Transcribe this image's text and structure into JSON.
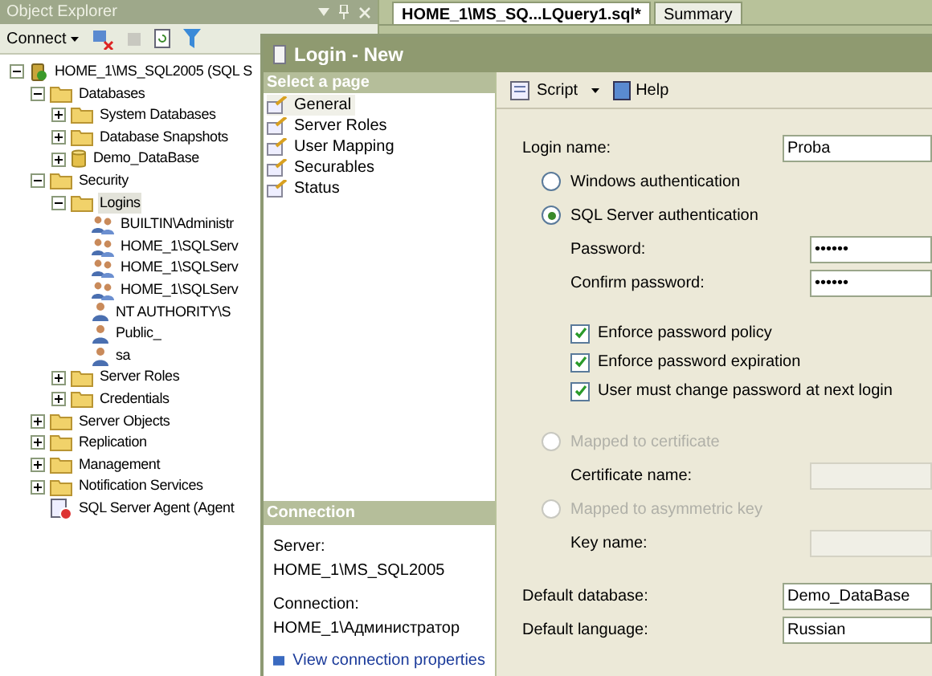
{
  "object_explorer": {
    "title": "Object Explorer",
    "connect": "Connect",
    "tree": [
      {
        "label": "HOME_1\\MS_SQL2005 (SQL S",
        "kind": "server",
        "expanded": true,
        "children": [
          {
            "label": "Databases",
            "kind": "folder",
            "expanded": true,
            "children": [
              {
                "label": "System Databases",
                "kind": "folder",
                "expanded": false
              },
              {
                "label": "Database Snapshots",
                "kind": "folder",
                "expanded": false
              },
              {
                "label": "Demo_DataBase",
                "kind": "database",
                "expanded": false
              }
            ]
          },
          {
            "label": "Security",
            "kind": "folder",
            "expanded": true,
            "children": [
              {
                "label": "Logins",
                "kind": "folder",
                "expanded": true,
                "selected": true,
                "children": [
                  {
                    "label": "BUILTIN\\Administr",
                    "kind": "group"
                  },
                  {
                    "label": "HOME_1\\SQLServ",
                    "kind": "group"
                  },
                  {
                    "label": "HOME_1\\SQLServ",
                    "kind": "group"
                  },
                  {
                    "label": "HOME_1\\SQLServ",
                    "kind": "group"
                  },
                  {
                    "label": "NT AUTHORITY\\S",
                    "kind": "user"
                  },
                  {
                    "label": "Public_",
                    "kind": "user"
                  },
                  {
                    "label": "sa",
                    "kind": "user"
                  }
                ]
              },
              {
                "label": "Server Roles",
                "kind": "folder",
                "expanded": false
              },
              {
                "label": "Credentials",
                "kind": "folder",
                "expanded": false
              }
            ]
          },
          {
            "label": "Server Objects",
            "kind": "folder",
            "expanded": false
          },
          {
            "label": "Replication",
            "kind": "folder",
            "expanded": false
          },
          {
            "label": "Management",
            "kind": "folder",
            "expanded": false
          },
          {
            "label": "Notification Services",
            "kind": "folder",
            "expanded": false
          },
          {
            "label": "SQL Server Agent (Agent",
            "kind": "agent"
          }
        ]
      }
    ]
  },
  "document_tabs": [
    {
      "label": "HOME_1\\MS_SQ...LQuery1.sql*",
      "selected": true
    },
    {
      "label": "Summary",
      "selected": false
    }
  ],
  "dialog": {
    "title": "Login - New",
    "select_page": {
      "heading": "Select a page",
      "items": [
        {
          "label": "General",
          "selected": true
        },
        {
          "label": "Server Roles",
          "selected": false
        },
        {
          "label": "User Mapping",
          "selected": false
        },
        {
          "label": "Securables",
          "selected": false
        },
        {
          "label": "Status",
          "selected": false
        }
      ]
    },
    "connection": {
      "heading": "Connection",
      "server_label": "Server:",
      "server": "HOME_1\\MS_SQL2005",
      "connection_label": "Connection:",
      "connection": "HOME_1\\Администратор",
      "link": "View connection properties"
    },
    "toolbar": {
      "script": "Script",
      "help": "Help"
    },
    "form": [
      [
        {
          "kind": "field",
          "label": "Login name:",
          "value": "Proba"
        },
        {
          "kind": "radio",
          "label": "Windows authentication",
          "selected": false,
          "disabled": false
        },
        {
          "kind": "radio",
          "label": "SQL Server authentication",
          "selected": true,
          "disabled": false
        },
        {
          "kind": "sub-field",
          "label": "Password:",
          "value": "••••••",
          "disabled": false
        },
        {
          "kind": "sub-field",
          "label": "Confirm password:",
          "value": "••••••",
          "disabled": false
        }
      ],
      [
        {
          "kind": "checkbox",
          "label": "Enforce password policy",
          "checked": true
        },
        {
          "kind": "checkbox",
          "label": "Enforce password expiration",
          "checked": true
        },
        {
          "kind": "checkbox",
          "label": "User must change password at next login",
          "checked": true
        }
      ],
      [
        {
          "kind": "radio",
          "label": "Mapped to certificate",
          "selected": false,
          "disabled": true
        },
        {
          "kind": "sub-field",
          "label": "Certificate name:",
          "disabled": true
        },
        {
          "kind": "radio",
          "label": "Mapped to asymmetric key",
          "selected": false,
          "disabled": true
        },
        {
          "kind": "sub-field",
          "label": "Key name:",
          "disabled": true
        }
      ],
      [
        {
          "kind": "field",
          "label": "Default database:",
          "value": "Demo_DataBase"
        },
        {
          "kind": "field",
          "label": "Default language:",
          "value": "Russian"
        }
      ]
    ]
  }
}
